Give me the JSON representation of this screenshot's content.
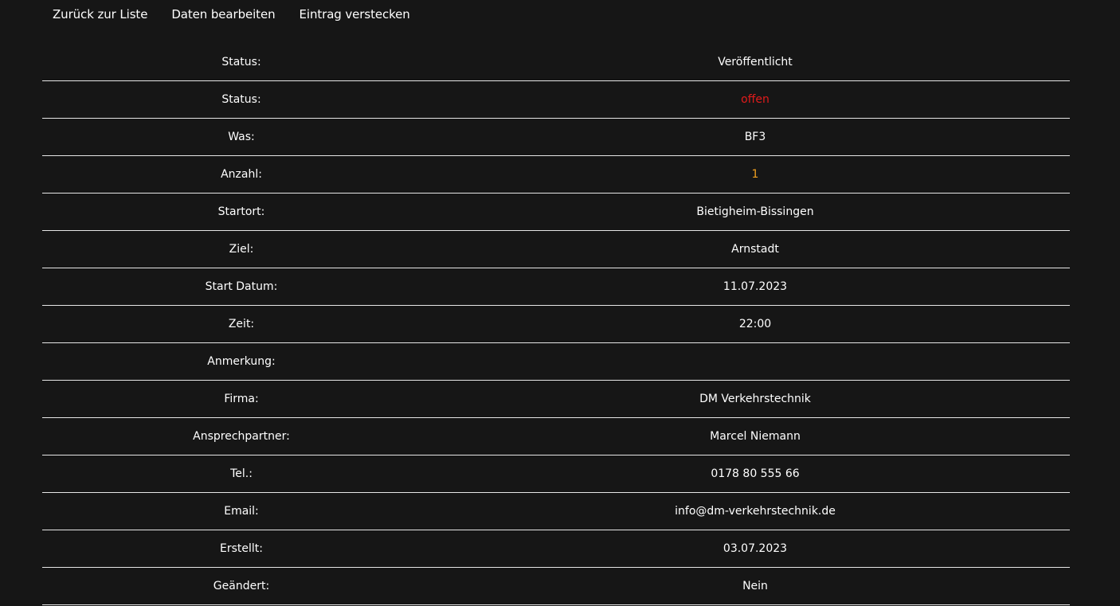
{
  "nav": {
    "back_label": "Zurück zur Liste",
    "edit_label": "Daten bearbeiten",
    "hide_label": "Eintrag verstecken"
  },
  "colors": {
    "background": "#161616",
    "text": "#ffffff",
    "status_open": "#e21b1b",
    "count": "#f0a020",
    "divider": "#e6e6e6"
  },
  "details": {
    "publish_status": {
      "label": "Status:",
      "value": "Veröffentlicht"
    },
    "status": {
      "label": "Status:",
      "value": "offen"
    },
    "was": {
      "label": "Was:",
      "value": "BF3"
    },
    "anzahl": {
      "label": "Anzahl:",
      "value": "1"
    },
    "startort": {
      "label": "Startort:",
      "value": "Bietigheim-Bissingen"
    },
    "ziel": {
      "label": "Ziel:",
      "value": "Arnstadt"
    },
    "start_datum": {
      "label": "Start Datum:",
      "value": "11.07.2023"
    },
    "zeit": {
      "label": "Zeit:",
      "value": "22:00"
    },
    "anmerkung": {
      "label": "Anmerkung:",
      "value": ""
    },
    "firma": {
      "label": "Firma:",
      "value": "DM Verkehrstechnik"
    },
    "ansprechpartner": {
      "label": "Ansprechpartner:",
      "value": "Marcel Niemann"
    },
    "tel": {
      "label": "Tel.:",
      "value": "0178 80 555 66"
    },
    "email": {
      "label": "Email:",
      "value": "info@dm-verkehrstechnik.de"
    },
    "erstellt": {
      "label": "Erstellt:",
      "value": "03.07.2023"
    },
    "geaendert": {
      "label": "Geändert:",
      "value": "Nein"
    }
  }
}
